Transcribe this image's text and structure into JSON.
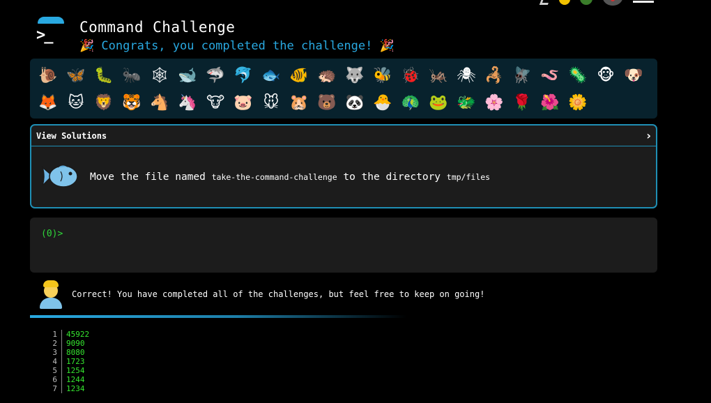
{
  "header": {
    "title": "Command Challenge",
    "congrats": "Congrats, you completed the challenge!",
    "party_icon": "🎉"
  },
  "badges": [
    "🐌",
    "🦋",
    "🐛",
    "🐜",
    "🕸",
    "🐋",
    "🦈",
    "🐬",
    "🐟",
    "🐠",
    "🦔",
    "🐺",
    "🐝",
    "🐞",
    "🦗",
    "🕷",
    "🦂",
    "🪰",
    "🪱",
    "🦠",
    "🐵",
    "🐶",
    "🦊",
    "🐱",
    "🦁",
    "🐯",
    "🐴",
    "🦄",
    "🐮",
    "🐷",
    "🐭",
    "🐹",
    "🐻",
    "🐼",
    "🐣",
    "🦚",
    "🐸",
    "🐲",
    "🌸",
    "🌹",
    "🌺",
    "🌼"
  ],
  "challenge": {
    "solutions_label": "View Solutions",
    "chevron": "›",
    "icon": "fish-icon",
    "text_prefix": "Move the file named",
    "file_name": "take-the-command-challenge",
    "text_middle": "to the directory",
    "directory": "tmp/files"
  },
  "terminal": {
    "prompt": "(0)>"
  },
  "status": {
    "message": "Correct! You have completed all of the challenges, but feel free to keep on going!"
  },
  "history": [
    {
      "num": "1",
      "value": "45922"
    },
    {
      "num": "2",
      "value": "9090"
    },
    {
      "num": "3",
      "value": "8080"
    },
    {
      "num": "4",
      "value": "1723"
    },
    {
      "num": "5",
      "value": "1254"
    },
    {
      "num": "6",
      "value": "1244"
    },
    {
      "num": "7",
      "value": "1234"
    }
  ],
  "colors": {
    "accent": "#29a9e1",
    "panel": "#08222d",
    "card": "#1c1c1c",
    "prompt_green": "#2fd63a"
  }
}
